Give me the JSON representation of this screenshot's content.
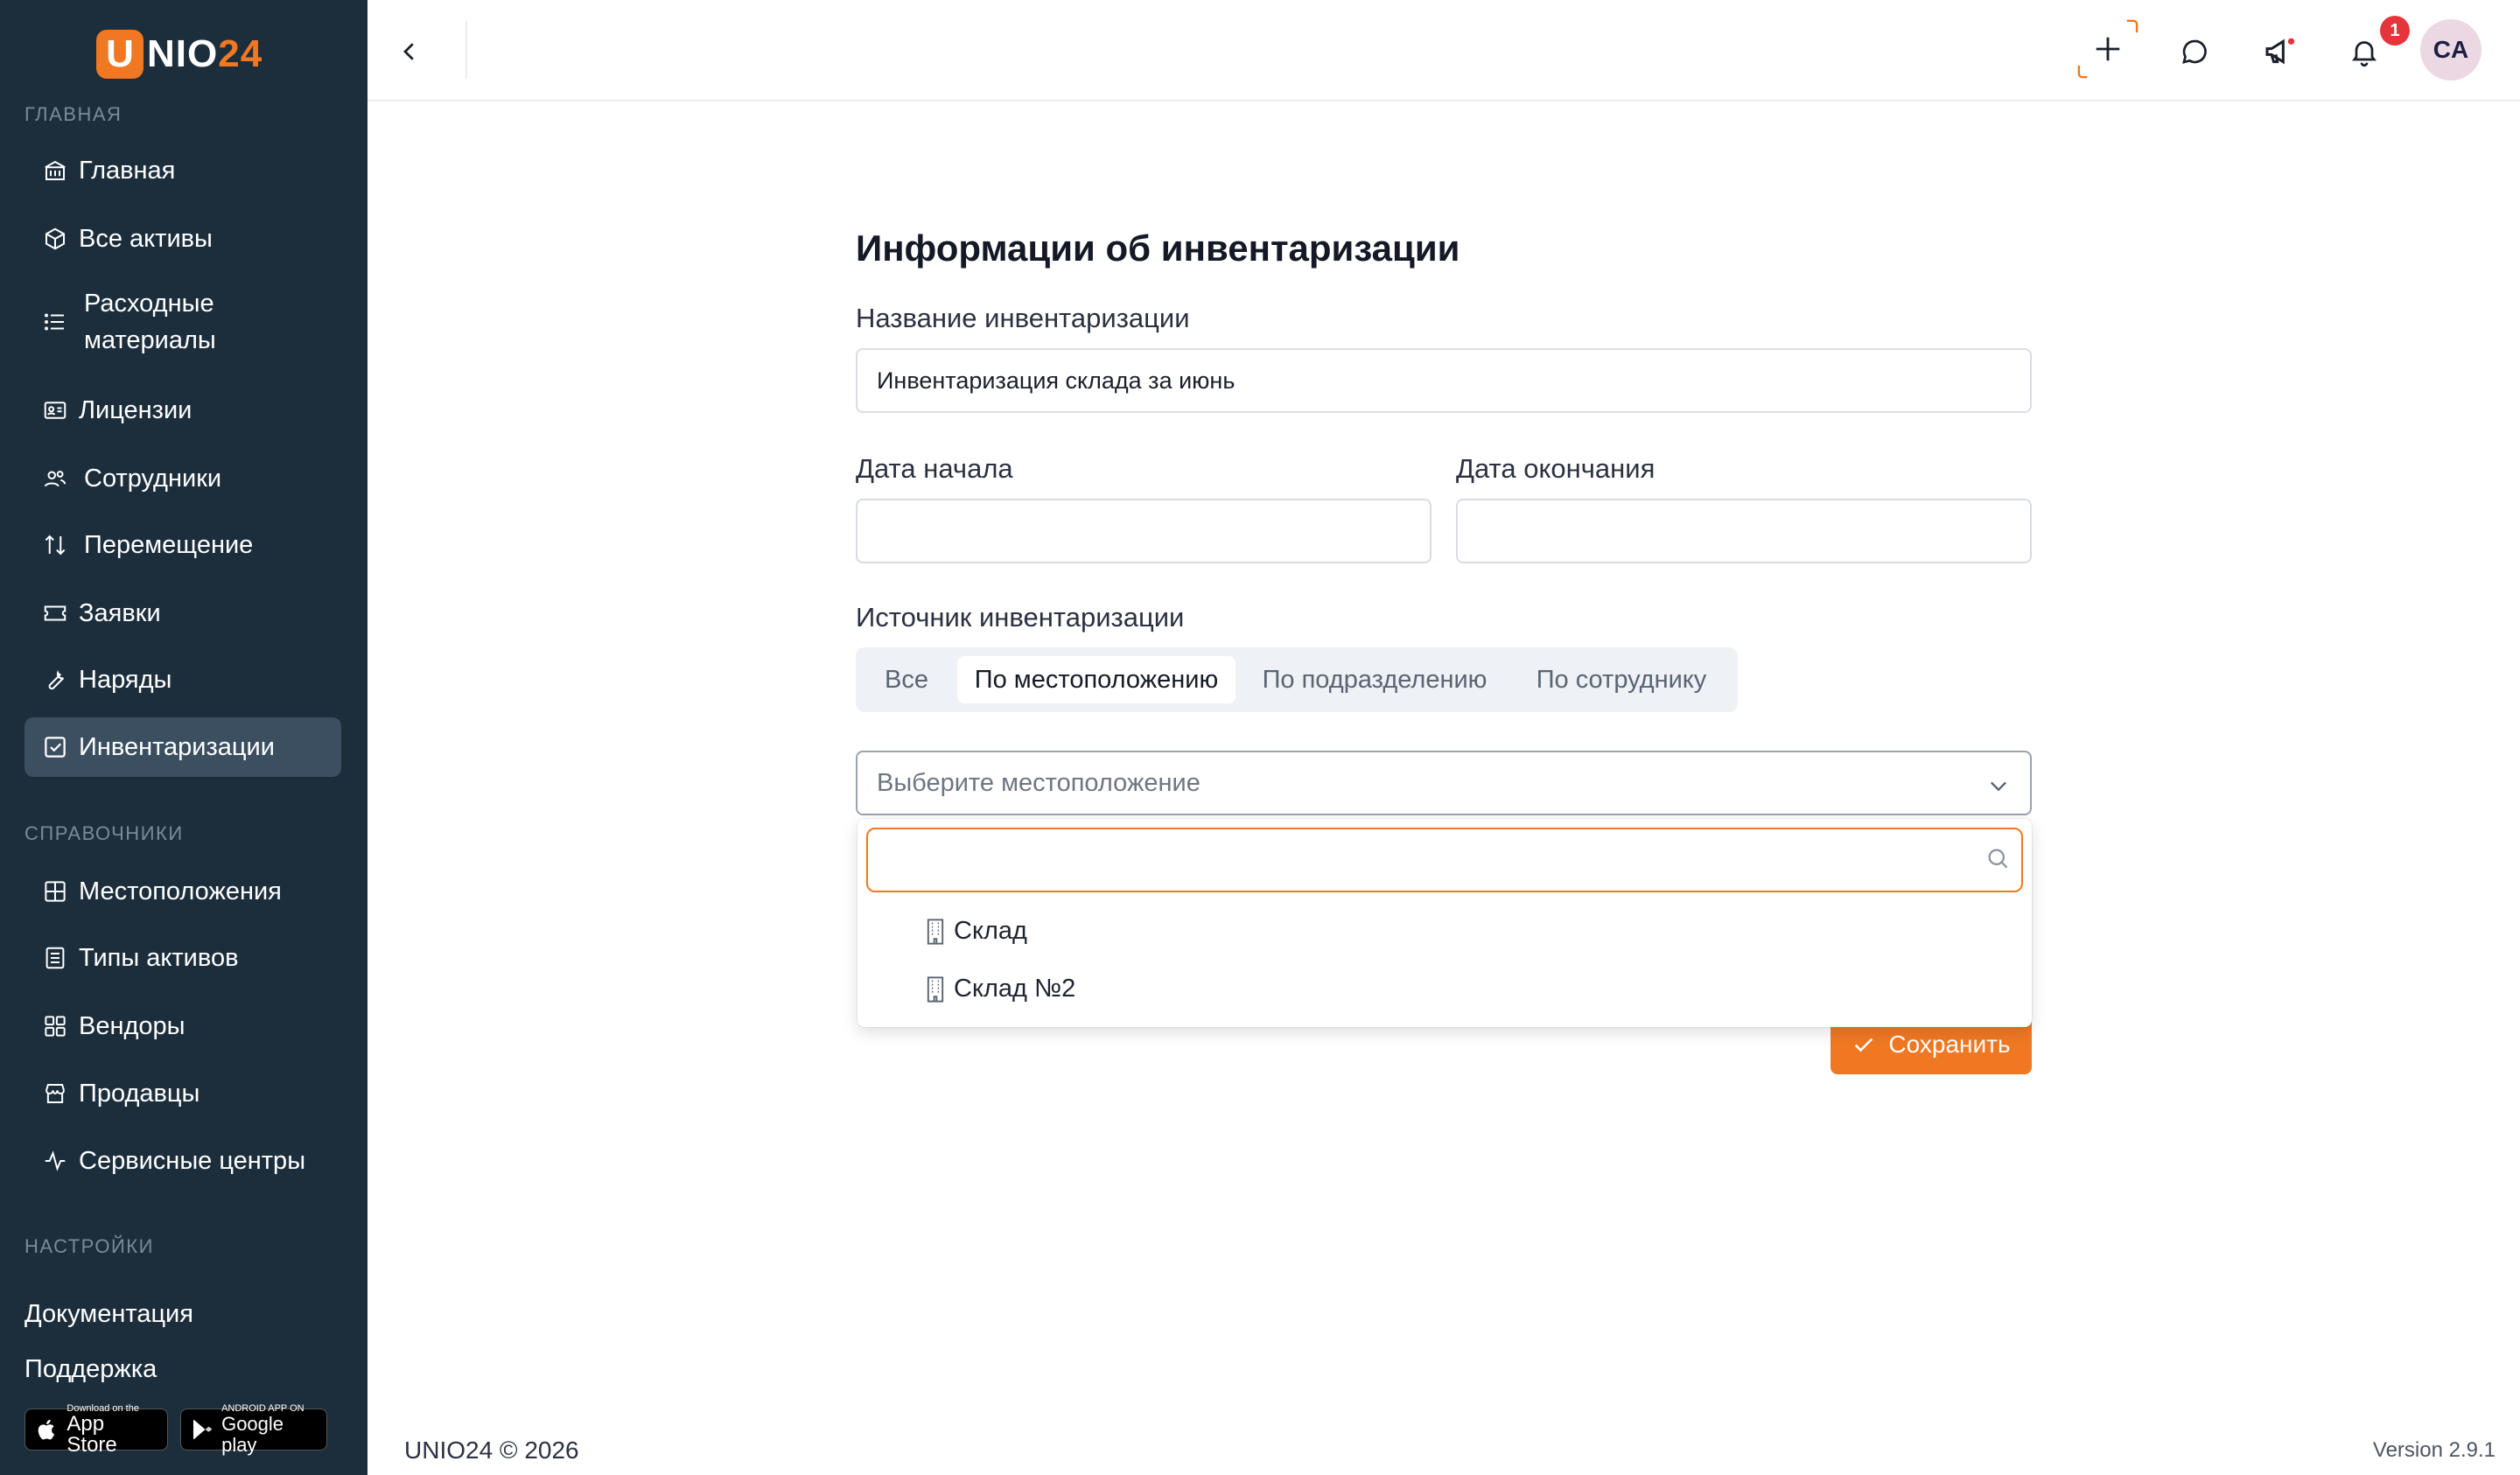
{
  "logo": {
    "letter": "U",
    "nio": "NIO",
    "num": "24"
  },
  "sidebar": {
    "sections": {
      "main": "ГЛАВНАЯ",
      "refs": "СПРАВОЧНИКИ",
      "settings": "НАСТРОЙКИ"
    },
    "items": [
      {
        "label": "Главная",
        "icon": "bank-icon"
      },
      {
        "label": "Все активы",
        "icon": "cube-icon"
      },
      {
        "label": "Расходные материалы",
        "icon": "list-icon"
      },
      {
        "label": "Лицензии",
        "icon": "id-card-icon"
      },
      {
        "label": "Сотрудники",
        "icon": "users-icon"
      },
      {
        "label": "Перемещение",
        "icon": "arrows-up-down-icon"
      },
      {
        "label": "Заявки",
        "icon": "ticket-icon"
      },
      {
        "label": "Наряды",
        "icon": "wrench-icon"
      },
      {
        "label": "Инвентаризации",
        "icon": "checkbox-icon",
        "active": true
      }
    ],
    "ref_items": [
      {
        "label": "Местоположения",
        "icon": "grid-icon"
      },
      {
        "label": "Типы активов",
        "icon": "document-list-icon"
      },
      {
        "label": "Вендоры",
        "icon": "apps-icon"
      },
      {
        "label": "Продавцы",
        "icon": "store-icon"
      },
      {
        "label": "Сервисные центры",
        "icon": "activity-icon"
      }
    ],
    "links": {
      "docs": "Документация",
      "support": "Поддержка"
    },
    "stores": {
      "appstore_small": "Download on the",
      "appstore_big": "App Store",
      "google_small": "ANDROID APP ON",
      "google_big": "Google play"
    }
  },
  "header": {
    "notification_count": "1",
    "avatar": "CA"
  },
  "form": {
    "title": "Информации об инвентаризации",
    "name_label": "Название инвентаризации",
    "name_value": "Инвентаризация склада за июнь",
    "start_label": "Дата начала",
    "end_label": "Дата окончания",
    "source_label": "Источник инвентаризации",
    "tabs": [
      "Все",
      "По местоположению",
      "По подразделению",
      "По сотруднику"
    ],
    "active_tab": "По местоположению",
    "select_placeholder": "Выберите местоположение",
    "options": [
      "Склад",
      "Склад №2"
    ],
    "save_label": "Сохранить"
  },
  "footer": {
    "copyright": "UNIO24 © 2026",
    "version": "Version 2.9.1"
  },
  "colors": {
    "sidebar_bg": "#1c2e3c",
    "accent": "#f07822",
    "active_item": "#3b4f60",
    "badge": "#e5353b"
  }
}
